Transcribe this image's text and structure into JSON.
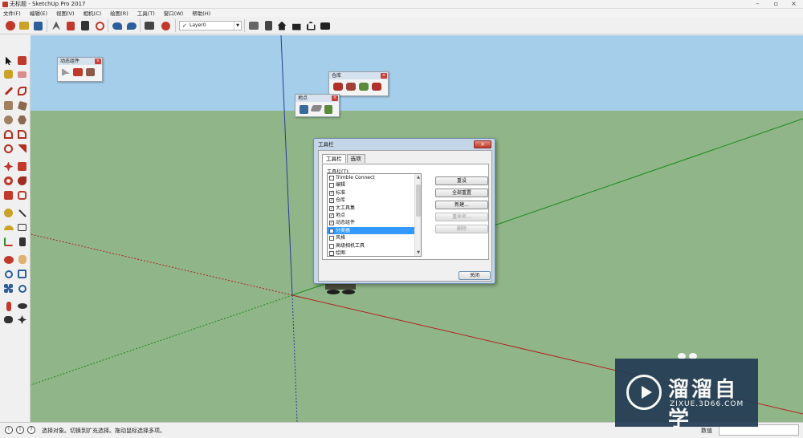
{
  "app": {
    "title": "无标题 - SketchUp Pro 2017",
    "window_controls": [
      "–",
      "▫",
      "×"
    ]
  },
  "menu": [
    "文件(F)",
    "编辑(E)",
    "视图(V)",
    "相机(C)",
    "绘图(R)",
    "工具(T)",
    "窗口(W)",
    "帮助(H)"
  ],
  "toolbar": {
    "layer_value": "Layer0",
    "layer_check": "✓"
  },
  "floating_toolbars": {
    "dynamic_components": "动态组件",
    "warehouse": "仓库",
    "location": "地点",
    "close": "×"
  },
  "dialog": {
    "title": "工具栏",
    "close": "×",
    "tabs": [
      "工具栏",
      "选项"
    ],
    "list_label": "工具栏(T):",
    "items": [
      {
        "label": "Trimble Connect",
        "checked": false,
        "selected": false
      },
      {
        "label": "编辑",
        "checked": false,
        "selected": false
      },
      {
        "label": "标准",
        "checked": true,
        "selected": false
      },
      {
        "label": "仓库",
        "checked": true,
        "selected": false
      },
      {
        "label": "大工具集",
        "checked": true,
        "selected": false
      },
      {
        "label": "地点",
        "checked": true,
        "selected": false
      },
      {
        "label": "动态组件",
        "checked": true,
        "selected": false
      },
      {
        "label": "分类器",
        "checked": false,
        "selected": true
      },
      {
        "label": "风格",
        "checked": false,
        "selected": false
      },
      {
        "label": "高级相机工具",
        "checked": false,
        "selected": false
      },
      {
        "label": "绘图",
        "checked": false,
        "selected": false
      }
    ],
    "buttons": [
      "重设",
      "全部重置",
      "新建...",
      "重命名...",
      "删除"
    ],
    "close_button": "关闭"
  },
  "status": {
    "text": "选择对象。切换到扩充选择。拖动鼠标选择多项。",
    "measure_label": "数值"
  },
  "watermark": {
    "cn": "溜溜自学",
    "en": "ZIXUE.3D66.COM"
  }
}
